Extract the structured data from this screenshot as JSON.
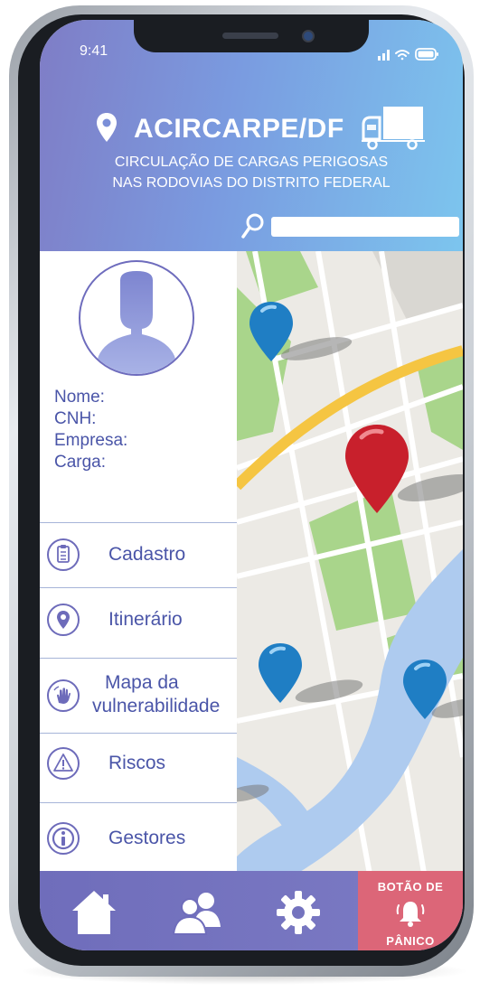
{
  "status_bar": {
    "time": "9:41"
  },
  "header": {
    "title": "ACIRCARPE/DF",
    "subtitle_line1": "CIRCULAÇÃO DE CARGAS PERIGOSAS",
    "subtitle_line2": "NAS RODOVIAS DO DISTRITO FEDERAL",
    "search_value": ""
  },
  "profile": {
    "name_label": "Nome:",
    "cnh_label": "CNH:",
    "company_label": "Empresa:",
    "cargo_label": "Carga:"
  },
  "menu": {
    "items": [
      {
        "label": "Cadastro",
        "icon": "clipboard-icon"
      },
      {
        "label": "Itinerário",
        "icon": "location-pin-icon"
      },
      {
        "label_line1": "Mapa da",
        "label_line2": "vulnerabilidade",
        "icon": "hand-icon"
      },
      {
        "label": "Riscos",
        "icon": "warning-icon"
      },
      {
        "label": "Gestores",
        "icon": "info-icon"
      }
    ]
  },
  "bottom_nav": {
    "items": [
      "home-icon",
      "users-icon",
      "gear-icon"
    ],
    "panic_line1": "BOTÃO DE",
    "panic_line2": "PÂNICO"
  },
  "colors": {
    "accent": "#6e6cbd",
    "text": "#4a55a8",
    "panic": "#dc6678",
    "pin_red": "#c8202c",
    "pin_blue": "#1f7ec4"
  }
}
